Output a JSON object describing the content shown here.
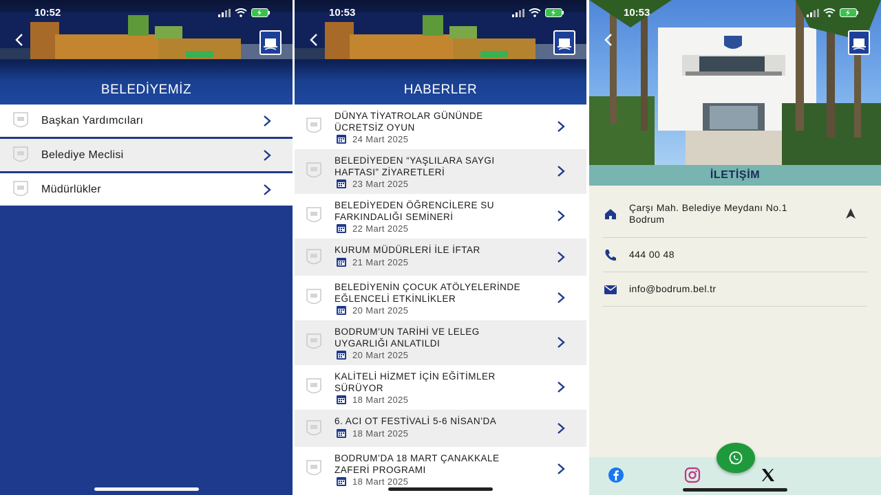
{
  "screen1": {
    "time": "10:52",
    "title": "BELEDİYEMİZ",
    "items": [
      {
        "label": "Başkan Yardımcıları"
      },
      {
        "label": "Belediye Meclisi"
      },
      {
        "label": "Müdürlükler"
      }
    ]
  },
  "screen2": {
    "time": "10:53",
    "title": "HABERLER",
    "news": [
      {
        "title": "DÜNYA TİYATROLAR GÜNÜNDE\nÜCRETSİZ OYUN",
        "date": "24 Mart 2025"
      },
      {
        "title": "BELEDİYEDEN “YAŞLILARA SAYGI\nHAFTASI” ZİYARETLERİ",
        "date": "23 Mart 2025"
      },
      {
        "title": "BELEDİYEDEN ÖĞRENCİLERE SU\nFARKINDALIĞI SEMİNERİ",
        "date": "22 Mart 2025"
      },
      {
        "title": "KURUM MÜDÜRLERİ İLE İFTAR",
        "date": "21 Mart 2025"
      },
      {
        "title": "BELEDİYENİN ÇOCUK ATÖLYELERİNDE\nEĞLENCELİ ETKİNLİKLER",
        "date": "20 Mart 2025"
      },
      {
        "title": "BODRUM’UN TARİHİ VE LELEG\nUYGARLIĞI ANLATILDI",
        "date": "20 Mart 2025"
      },
      {
        "title": "KALİTELİ HİZMET İÇİN EĞİTİMLER\nSÜRÜYOR",
        "date": "18 Mart 2025"
      },
      {
        "title": "6. ACI OT FESTİVALİ 5-6 NİSAN’DA",
        "date": "18 Mart 2025"
      },
      {
        "title": "BODRUM’DA 18 MART ÇANAKKALE\nZAFERİ PROGRAMI",
        "date": "18 Mart 2025"
      }
    ]
  },
  "screen3": {
    "time": "10:53",
    "title": "İLETİŞİM",
    "address": "Çarşı Mah. Belediye Meydanı No.1\nBodrum",
    "phone": "444 00 48",
    "email": "info@bodrum.bel.tr"
  },
  "colors": {
    "primary": "#1e3a8c",
    "teal": "#78b4b0",
    "whatsapp": "#1e9a3c",
    "facebook": "#1877f2",
    "instagram": "#c13584"
  },
  "icons": [
    "back-arrow-icon",
    "municipality-logo-icon",
    "chevron-right-icon",
    "calendar-icon",
    "home-icon",
    "phone-icon",
    "mail-icon",
    "navigation-arrow-icon",
    "whatsapp-icon",
    "facebook-icon",
    "instagram-icon",
    "x-twitter-icon"
  ]
}
